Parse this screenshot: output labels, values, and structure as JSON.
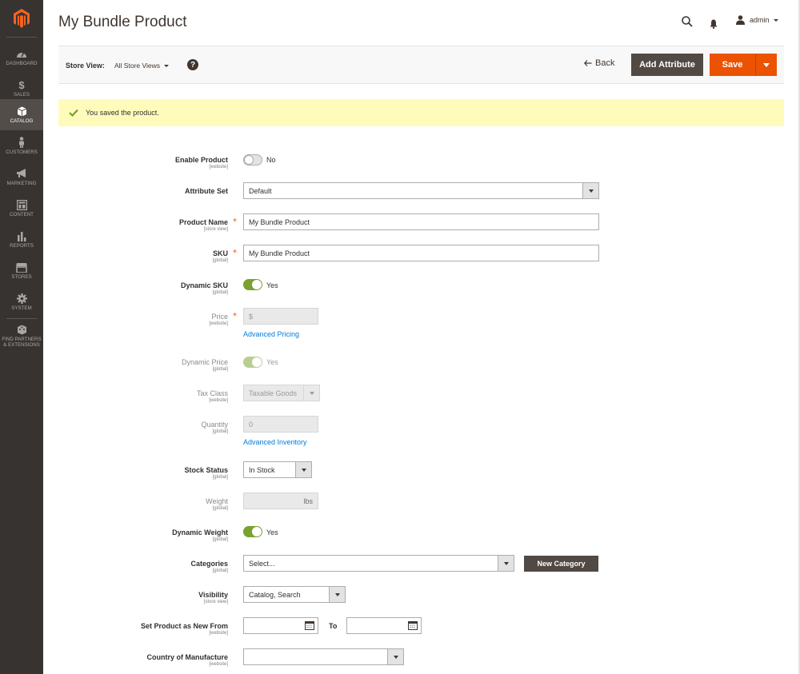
{
  "sidebar": {
    "logo": "magento-logo",
    "items": [
      {
        "label": "Dashboard",
        "icon": "dashboard-icon"
      },
      {
        "label": "Sales",
        "icon": "dollar-icon"
      },
      {
        "label": "Catalog",
        "icon": "box-icon",
        "active": true
      },
      {
        "label": "Customers",
        "icon": "person-icon"
      },
      {
        "label": "Marketing",
        "icon": "megaphone-icon"
      },
      {
        "label": "Content",
        "icon": "layout-icon"
      },
      {
        "label": "Reports",
        "icon": "bar-chart-icon"
      },
      {
        "label": "Stores",
        "icon": "storefront-icon"
      },
      {
        "label": "System",
        "icon": "gear-icon"
      },
      {
        "label": "Find Partners & Extensions",
        "icon": "extensions-icon"
      }
    ]
  },
  "header": {
    "title": "My Bundle Product",
    "user": "admin"
  },
  "toolbar": {
    "store_view_label": "Store View:",
    "store_view_value": "All Store Views",
    "help": "?",
    "back_label": "Back",
    "add_attribute_label": "Add Attribute",
    "save_label": "Save"
  },
  "message": {
    "text": "You saved the product."
  },
  "form": {
    "enable_product": {
      "label": "Enable Product",
      "scope": "[website]",
      "value": "No"
    },
    "attribute_set": {
      "label": "Attribute Set",
      "value": "Default"
    },
    "product_name": {
      "label": "Product Name",
      "scope": "[store view]",
      "value": "My Bundle Product"
    },
    "sku": {
      "label": "SKU",
      "scope": "[global]",
      "value": "My Bundle Product"
    },
    "dynamic_sku": {
      "label": "Dynamic SKU",
      "scope": "[global]",
      "value": "Yes"
    },
    "price": {
      "label": "Price",
      "scope": "[website]",
      "value": "$",
      "link": "Advanced Pricing"
    },
    "dynamic_price": {
      "label": "Dynamic Price",
      "scope": "[global]",
      "value": "Yes"
    },
    "tax_class": {
      "label": "Tax Class",
      "scope": "[website]",
      "value": "Taxable Goods"
    },
    "quantity": {
      "label": "Quantity",
      "scope": "[global]",
      "value": "0",
      "link": "Advanced Inventory"
    },
    "stock_status": {
      "label": "Stock Status",
      "scope": "[global]",
      "value": "In Stock"
    },
    "weight": {
      "label": "Weight",
      "scope": "[global]",
      "unit": "lbs"
    },
    "dynamic_weight": {
      "label": "Dynamic Weight",
      "scope": "[global]",
      "value": "Yes"
    },
    "categories": {
      "label": "Categories",
      "scope": "[global]",
      "placeholder": "Select...",
      "new_button": "New Category"
    },
    "visibility": {
      "label": "Visibility",
      "scope": "[store view]",
      "value": "Catalog, Search"
    },
    "new_from": {
      "label": "Set Product as New From",
      "scope": "[website]",
      "to_label": "To",
      "from_value": "",
      "to_value": ""
    },
    "country": {
      "label": "Country of Manufacture",
      "scope": "[website]",
      "value": ""
    }
  },
  "colors": {
    "sidebar_bg": "#373330",
    "accent_orange": "#eb5202",
    "dark_button": "#514943",
    "toggle_on": "#79a22e",
    "message_bg": "#fffbbb",
    "link": "#007bdb"
  }
}
